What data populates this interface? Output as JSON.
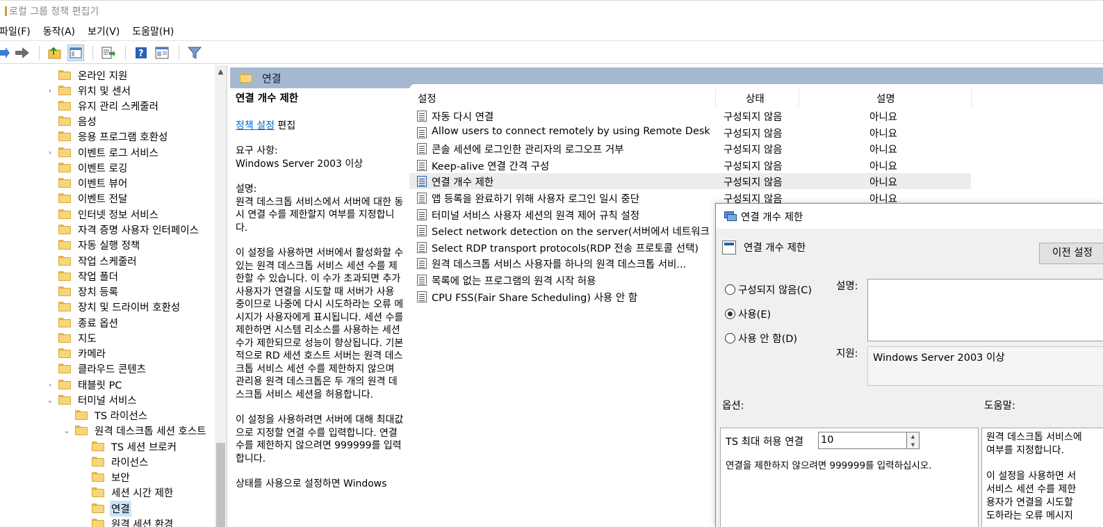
{
  "window": {
    "title": "로컬 그룹 정책 편집기"
  },
  "menu": [
    "파일(F)",
    "동작(A)",
    "보기(V)",
    "도움말(H)"
  ],
  "toolbar": [
    "back-arrow-icon",
    "forward-arrow-icon",
    "up-folder-icon",
    "show-hide-tree-icon",
    "export-list-icon",
    "help-icon",
    "properties-icon",
    "filter-icon"
  ],
  "tree": [
    {
      "label": "온라인 지원",
      "expand": ""
    },
    {
      "label": "위치 및 센서",
      "expand": "›"
    },
    {
      "label": "유지 관리 스케줄러",
      "expand": ""
    },
    {
      "label": "음성",
      "expand": ""
    },
    {
      "label": "응용 프로그램 호환성",
      "expand": ""
    },
    {
      "label": "이벤트 로그 서비스",
      "expand": "›"
    },
    {
      "label": "이벤트 로깅",
      "expand": ""
    },
    {
      "label": "이벤트 뷰어",
      "expand": ""
    },
    {
      "label": "이벤트 전달",
      "expand": ""
    },
    {
      "label": "인터넷 정보 서비스",
      "expand": ""
    },
    {
      "label": "자격 증명 사용자 인터페이스",
      "expand": ""
    },
    {
      "label": "자동 실행 정책",
      "expand": ""
    },
    {
      "label": "작업 스케줄러",
      "expand": ""
    },
    {
      "label": "작업 폴더",
      "expand": ""
    },
    {
      "label": "장치 등록",
      "expand": ""
    },
    {
      "label": "장치 및 드라이버 호환성",
      "expand": ""
    },
    {
      "label": "종료 옵션",
      "expand": ""
    },
    {
      "label": "지도",
      "expand": ""
    },
    {
      "label": "카메라",
      "expand": ""
    },
    {
      "label": "클라우드 콘텐츠",
      "expand": ""
    },
    {
      "label": "태블릿 PC",
      "expand": "›"
    },
    {
      "label": "터미널 서비스",
      "expand": "⌄"
    },
    {
      "label": "TS 라이선스",
      "expand": ""
    },
    {
      "label": "원격 데스크톱 세션 호스트",
      "expand": "⌄"
    },
    {
      "label": "TS 세션 브로커",
      "expand": ""
    },
    {
      "label": "라이선스",
      "expand": ""
    },
    {
      "label": "보안",
      "expand": ""
    },
    {
      "label": "세션 시간 제한",
      "expand": ""
    },
    {
      "label": "연결",
      "expand": ""
    },
    {
      "label": "원격 세션 환경",
      "expand": ""
    }
  ],
  "pane": {
    "header": "연결",
    "desc_title": "연결 개수 제한",
    "policy_link": "정책 설정",
    "edit": " 편집",
    "req_label": "요구 사항:",
    "req_value": "Windows Server 2003 이상",
    "desc_label": "설명:",
    "desc_p1": "원격 데스크톱 서비스에서 서버에 대한 동시 연결 수를 제한할지 여부를 지정합니다.",
    "desc_p2": "이 설정을 사용하면 서버에서 활성화할 수 있는 원격 데스크톱 서비스 세션 수를 제한할 수 있습니다. 이 수가 초과되면 추가 사용자가 연결을 시도할 때 서버가 사용 중이므로 나중에 다시 시도하라는 오류 메시지가 사용자에게 표시됩니다. 세션 수를 제한하면 시스템 리소스를 사용하는 세션 수가 제한되므로 성능이 향상됩니다. 기본적으로 RD 세션 호스트 서버는 원격 데스크톱 서비스 세션 수를 제한하지 않으며 관리용 원격 데스크톱은 두 개의 원격 데스크톱 서비스 세션을 허용합니다.",
    "desc_p3": "이 설정을 사용하려면 서버에 대해 최대값으로 지정할 연결 수를 입력합니다. 연결 수를 제한하지 않으려면 999999를 입력합니다.",
    "desc_p4": "상태를 사용으로 설정하면 Windows"
  },
  "columns": {
    "setting": "설정",
    "state": "상태",
    "comment": "설명"
  },
  "settings": [
    {
      "name": "자동 다시 연결",
      "state": "구성되지 않음",
      "comment": "아니요"
    },
    {
      "name": "Allow users to connect remotely by using Remote Desktop ...",
      "state": "구성되지 않음",
      "comment": "아니요"
    },
    {
      "name": "콘솔 세션에 로그인한 관리자의 로그오프 거부",
      "state": "구성되지 않음",
      "comment": "아니요"
    },
    {
      "name": "Keep-alive 연결 간격 구성",
      "state": "구성되지 않음",
      "comment": "아니요"
    },
    {
      "name": "연결 개수 제한",
      "state": "구성되지 않음",
      "comment": "아니요"
    },
    {
      "name": "앱 등록을 완료하기 위해 사용자 로그인 일시 중단",
      "state": "구성되지 않음",
      "comment": "아니요"
    },
    {
      "name": "터미널 서비스 사용자 세션의 원격 제어 규칙 설정",
      "state": "",
      "comment": ""
    },
    {
      "name": "Select network detection on the server(서버에서 네트워크 ...",
      "state": "",
      "comment": ""
    },
    {
      "name": "Select RDP transport protocols(RDP 전송 프로토콜 선택)",
      "state": "",
      "comment": ""
    },
    {
      "name": "원격 데스크톱 서비스 사용자를 하나의 원격 데스크톱 서비...",
      "state": "",
      "comment": ""
    },
    {
      "name": "목록에 없는 프로그램의 원격 시작 허용",
      "state": "",
      "comment": ""
    },
    {
      "name": "CPU FSS(Fair Share Scheduling) 사용 안 함",
      "state": "",
      "comment": ""
    }
  ],
  "dialog": {
    "title": "연결 개수 제한",
    "subtitle": "연결 개수 제한",
    "prev_button": "이전 설정",
    "radios": [
      "구성되지 않음(C)",
      "사용(E)",
      "사용 안 함(D)"
    ],
    "selected_radio": "사용(E)",
    "comment_label": "설명:",
    "support_label": "지원:",
    "support_value": "Windows Server 2003 이상",
    "options_label": "옵션:",
    "help_label": "도움말:",
    "max_label": "TS 최대 허용 연결",
    "max_value": "10",
    "hint": "연결을 제한하지 않으려면 999999를 입력하십시오.",
    "help_p1a": "원격 데스크톱 서비스에",
    "help_p1b": "여부를 지정합니다.",
    "help_p2a": "이 설정을 사용하면 서",
    "help_p2b": "서비스 세션 수를 제한",
    "help_p2c": "용자가 연결을 시도할",
    "help_p2d": "도하라는 오류 메시지"
  }
}
